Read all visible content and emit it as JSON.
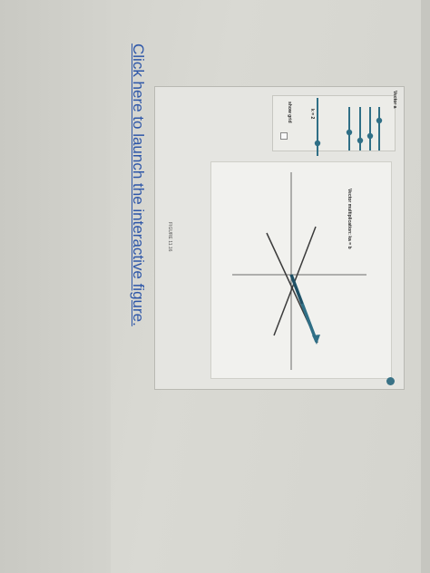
{
  "link": {
    "text": "Click here to launch the interactive figure."
  },
  "applet": {
    "heading": "Vector a",
    "function_label": "Vector multiplication: ka = b",
    "equation": "k = 2",
    "figure_label": "FIGURE 11.16",
    "grid_label": "show grid",
    "grid_checked": false,
    "accent_color": "#3a7286"
  }
}
